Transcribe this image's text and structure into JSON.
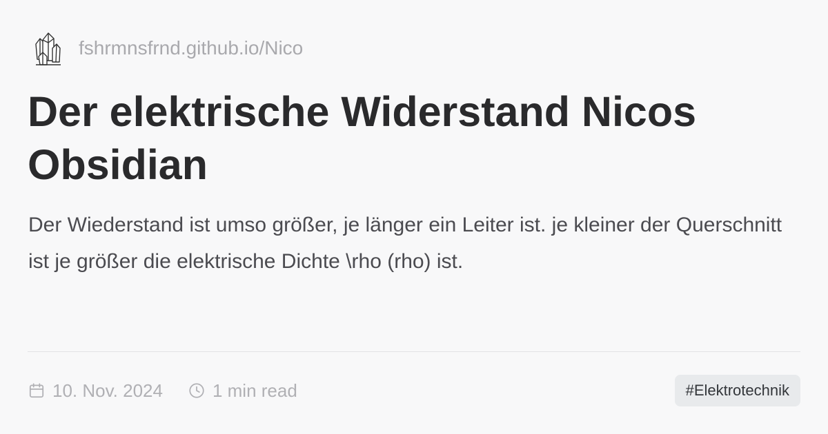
{
  "site": {
    "logo_icon": "crystal-icon",
    "url": "fshrmnsfrnd.github.io/Nico"
  },
  "article": {
    "title": "Der elektrische Widerstand Nicos Obsidian",
    "description": "Der Wiederstand ist umso größer, je länger ein Leiter ist. je kleiner der Querschnitt ist je größer die elektrische Dichte \\rho (rho) ist."
  },
  "meta": {
    "date_icon": "calendar-icon",
    "date": "10. Nov. 2024",
    "reading_icon": "clock-icon",
    "reading_time": "1 min read"
  },
  "tags": [
    "#Elektrotechnik"
  ],
  "colors": {
    "background": "#f8f8f9",
    "title": "#2a2a2c",
    "muted": "#b0b0b4",
    "tag_background": "#e8eaec"
  }
}
